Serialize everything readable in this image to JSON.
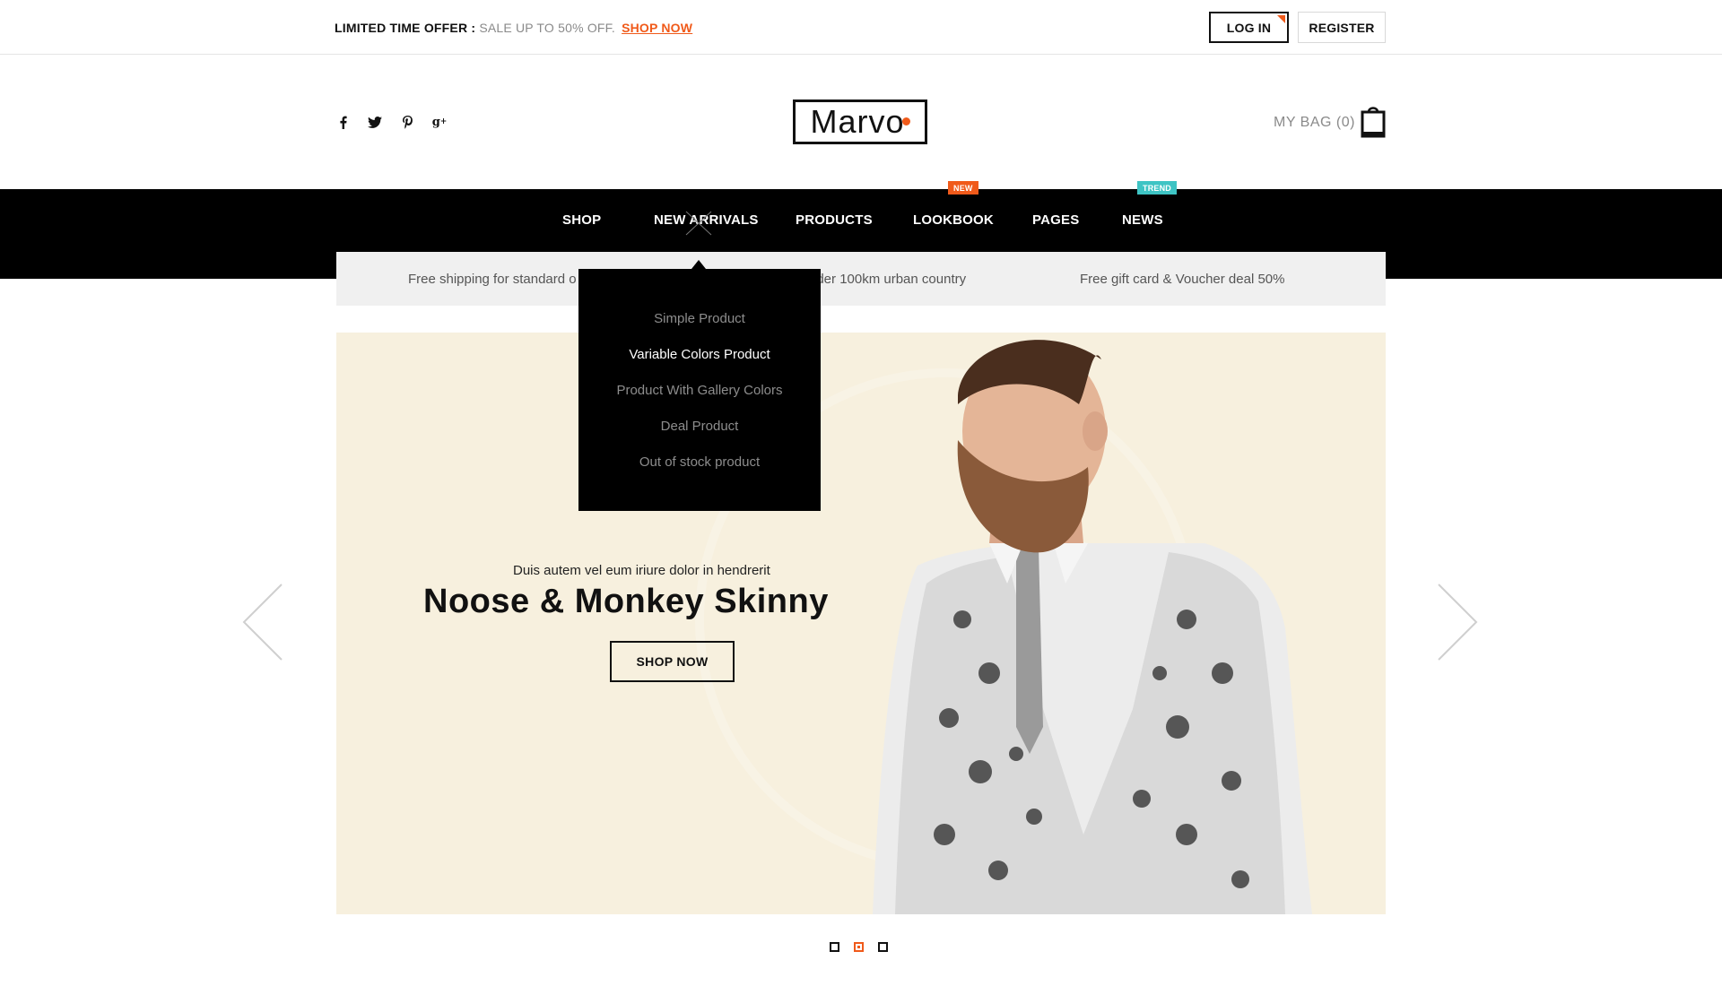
{
  "topbar": {
    "offer_label": "LIMITED TIME OFFER :",
    "offer_text": "SALE UP TO 50% OFF.",
    "offer_link": "SHOP NOW",
    "login": "LOG IN",
    "register": "REGISTER"
  },
  "header": {
    "social": [
      {
        "icon": "facebook-icon",
        "glyph": "f"
      },
      {
        "icon": "twitter-icon",
        "glyph": "t"
      },
      {
        "icon": "pinterest-icon",
        "glyph": "p"
      },
      {
        "icon": "google-plus-icon",
        "glyph": "g+"
      }
    ],
    "logo": "Marvo",
    "bag_label": "MY BAG (0)",
    "bag_icon": "shopping-bag-icon"
  },
  "nav": {
    "items": [
      "SHOP",
      "NEW ARRIVALS",
      "PRODUCTS",
      "LOOKBOOK",
      "PAGES",
      "NEWS"
    ],
    "badge_new": "NEW",
    "badge_trend": "TREND"
  },
  "dropdown": {
    "items": [
      "Simple Product",
      "Variable Colors Product",
      "Product With Gallery Colors",
      "Deal Product",
      "Out of stock product"
    ],
    "highlighted": "Variable Colors Product"
  },
  "info_strip": {
    "left": "Free shipping for standard o",
    "middle": "nder 100km urban country",
    "right": "Free gift card & Voucher deal 50%"
  },
  "hero": {
    "subtitle": "Duis autem vel eum iriure dolor in hendrerit",
    "title": "Noose & Monkey Skinny",
    "button": "SHOP NOW",
    "active_slide": 2,
    "slide_count": 3
  },
  "colors": {
    "accent": "#f05a1a",
    "trend": "#3ec4c4",
    "hero_bg": "#f7f0de",
    "nav_bg": "#000000"
  }
}
